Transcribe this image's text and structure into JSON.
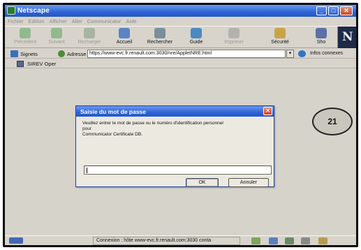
{
  "window": {
    "title": "Netscape",
    "brand_icon": "netscape-n-logo"
  },
  "menu": [
    "Fichier",
    "Edition",
    "Afficher",
    "Aller",
    "Communicator",
    "Aide"
  ],
  "toolbar": {
    "precedent": "Précédent",
    "suivant": "Suivant",
    "recharger": "Recharger",
    "accueil": "Accueil",
    "rechercher": "Rechercher",
    "guide": "Guide",
    "imprimer": "Imprimer",
    "securite": "Sécurité",
    "shop": "Sho"
  },
  "location": {
    "bookmarks_label": "Signets",
    "address_label": "Adresse :",
    "url": "https://www-evc.fr.renault.com:3030/nre/AppletNRE.html",
    "related_label": "Infos connexes"
  },
  "personal_toolbar": {
    "item": "SIREV Oper"
  },
  "dialog": {
    "title": "Saisie du mot de passe",
    "message_line1": "Veuillez entrer le mot de passe ou le numéro d'identification personnel",
    "message_line2": "pour",
    "message_line3": "Communicator Certificate DB.",
    "password_value": "",
    "ok_label": "OK",
    "cancel_label": "Annuler"
  },
  "callout": {
    "number": "21"
  },
  "status": {
    "message": "Connexion : hôte www-evc.fr.renault.com:3030 conta"
  },
  "colors": {
    "titlebar": "#2f64d6",
    "close_button": "#cf4527",
    "background": "#d6d3cb"
  }
}
